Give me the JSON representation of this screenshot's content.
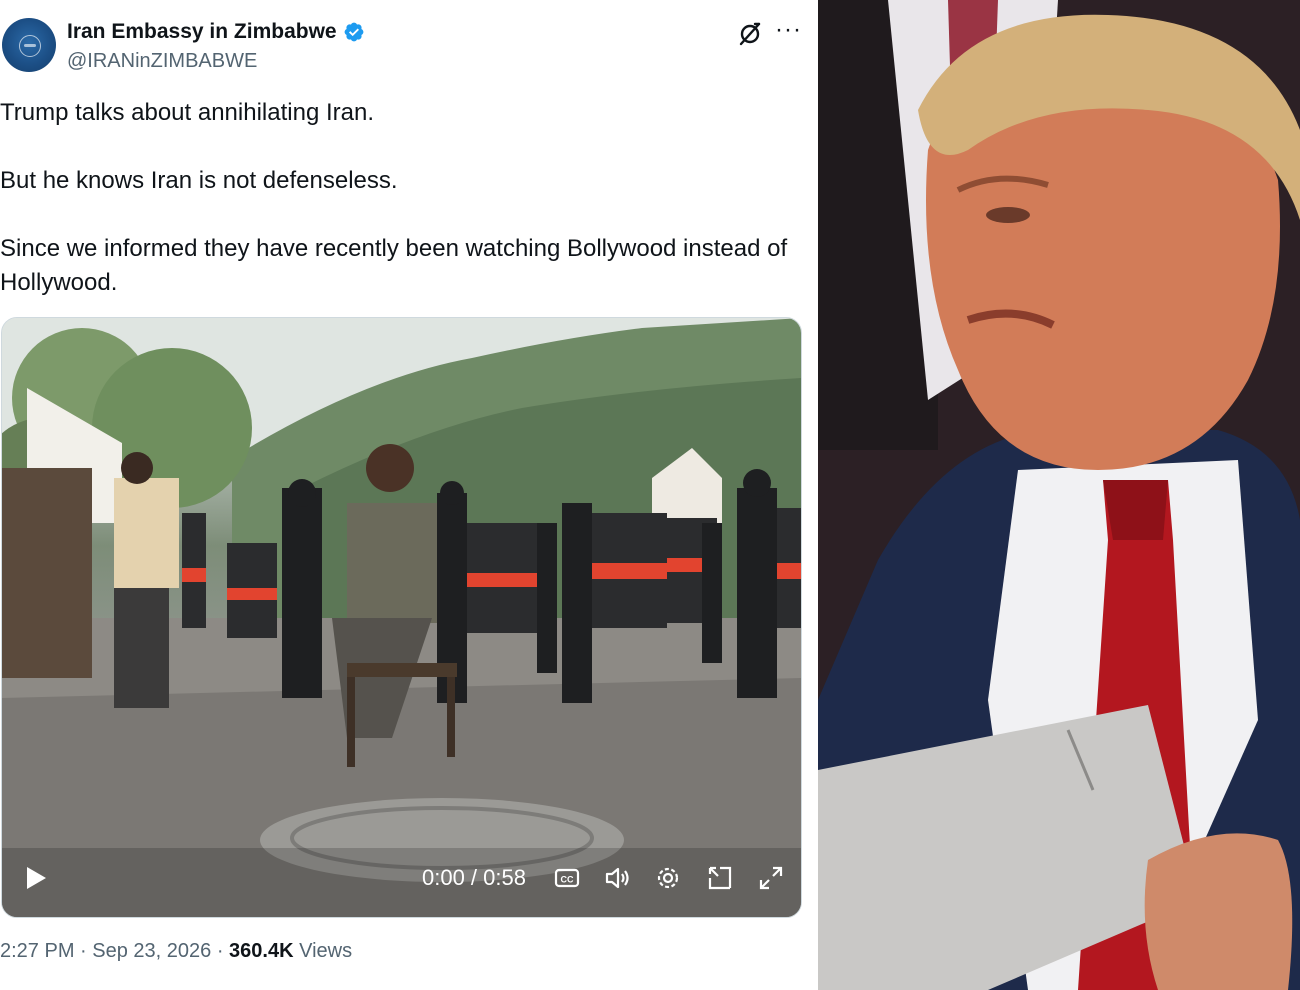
{
  "tweet": {
    "display_name": "Iran Embassy in Zimbabwe",
    "handle": "@IRANinZIMBABWE",
    "paragraphs": [
      "Trump talks about annihilating Iran.",
      "But he knows Iran is not defenseless.",
      "Since we informed they have recently been watching Bollywood instead of Hollywood."
    ],
    "video": {
      "time": "0:00 / 0:58"
    },
    "meta": {
      "time": "2:27 PM",
      "sep1": " · ",
      "date": "Sep 23, 2026",
      "sep2": " · ",
      "views_count": "360.4K",
      "views_label": " Views"
    }
  },
  "icons": {
    "verified": "verified-badge-icon",
    "grok": "grok-icon",
    "more": "more-options-icon",
    "play": "play-icon",
    "captions": "closed-captions-icon",
    "volume": "volume-icon",
    "settings": "gear-icon",
    "pip": "picture-in-picture-icon",
    "fullscreen": "fullscreen-icon"
  },
  "colors": {
    "verified_blue": "#1d9bf0",
    "text_primary": "#0f1419",
    "text_secondary": "#536471",
    "border": "#cfd9de"
  }
}
